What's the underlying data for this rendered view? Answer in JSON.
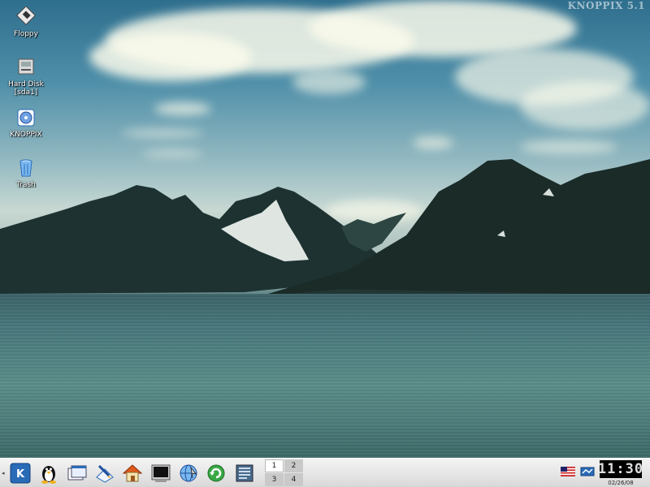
{
  "watermark": "KNOPPIX 5.1",
  "desktop_icons": [
    {
      "label": "Floppy",
      "icon": "floppy-icon"
    },
    {
      "label": "Hard Disk\n[sda1]",
      "icon": "hard-disk-icon"
    },
    {
      "label": "KNOPPIX",
      "icon": "knoppix-cd-icon"
    },
    {
      "label": "Trash",
      "icon": "trash-icon"
    }
  ],
  "taskbar": {
    "launchers": [
      "kde-menu-icon",
      "penguin-icon",
      "window-list-icon",
      "text-editor-icon",
      "home-folder-icon",
      "terminal-icon",
      "konqueror-icon",
      "refresh-icon",
      "documents-icon"
    ],
    "pager": [
      "1",
      "2",
      "3",
      "4"
    ],
    "active_desktop": "1",
    "tray": [
      "us-flag-icon",
      "network-monitor-icon"
    ],
    "clock": "11:30",
    "date": "02/26/08"
  },
  "colors": {
    "taskbar": "#e4e4e4",
    "kde_blue": "#2a6bb8"
  }
}
